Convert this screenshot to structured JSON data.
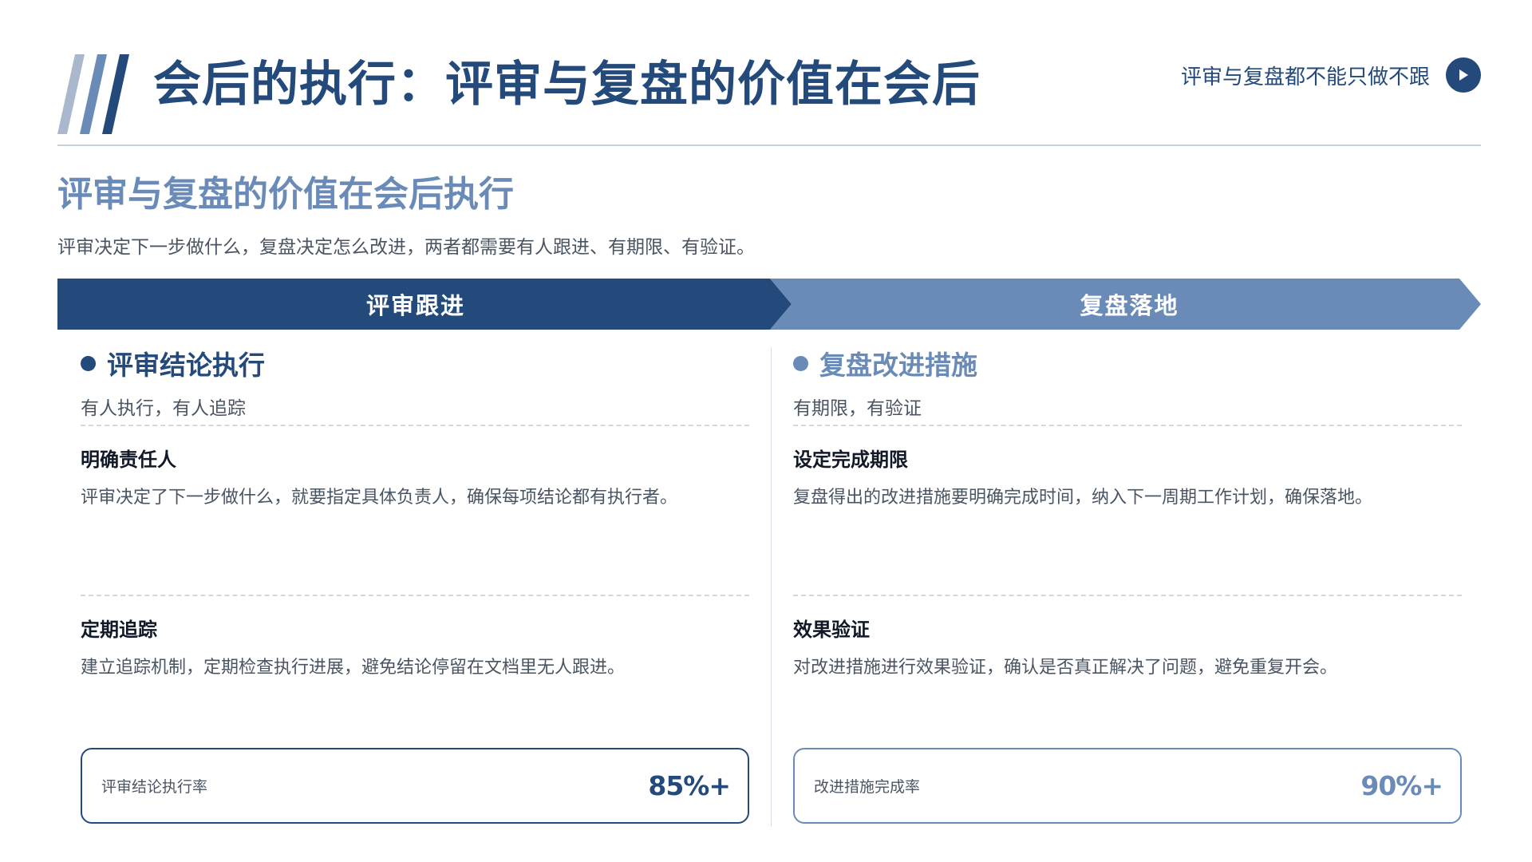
{
  "header": {
    "title": "会后的执行：评审与复盘的价值在会后",
    "tagline": "评审与复盘都不能只做不跟"
  },
  "section": {
    "title": "评审与复盘的价值在会后执行",
    "desc": "评审决定下一步做什么，复盘决定怎么改进，两者都需要有人跟进、有期限、有验证。"
  },
  "colors": {
    "primary": "#234a7a",
    "secondary": "#6a8bb8",
    "line": "#c4d0dc"
  },
  "icons": {
    "header_slashes": "slash-stripes-icon",
    "tagline_button": "play-icon",
    "column_marker": "dot-icon"
  },
  "left": {
    "banner": "评审跟进",
    "title": "评审结论执行",
    "subtitle": "有人执行，有人追踪",
    "items": [
      {
        "title": "明确责任人",
        "desc": "评审决定了下一步做什么，就要指定具体负责人，确保每项结论都有执行者。"
      },
      {
        "title": "定期追踪",
        "desc": "建立追踪机制，定期检查执行进展，避免结论停留在文档里无人跟进。"
      }
    ],
    "metric": {
      "label": "评审结论执行率",
      "value": "85%+"
    }
  },
  "right": {
    "banner": "复盘落地",
    "title": "复盘改进措施",
    "subtitle": "有期限，有验证",
    "items": [
      {
        "title": "设定完成期限",
        "desc": "复盘得出的改进措施要明确完成时间，纳入下一周期工作计划，确保落地。"
      },
      {
        "title": "效果验证",
        "desc": "对改进措施进行效果验证，确认是否真正解决了问题，避免重复开会。"
      }
    ],
    "metric": {
      "label": "改进措施完成率",
      "value": "90%+"
    }
  }
}
